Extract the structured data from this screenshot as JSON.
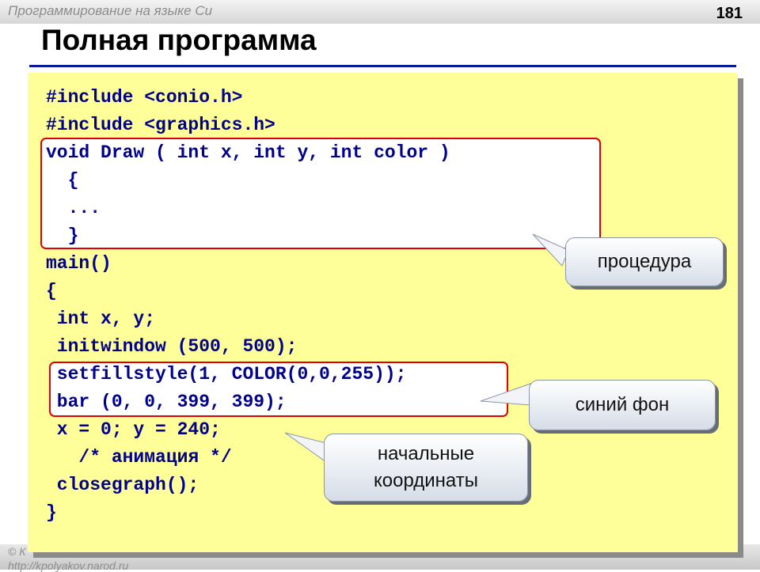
{
  "header": {
    "course": "Программирование на языке Си",
    "page_number": "181"
  },
  "slide": {
    "title": "Полная программа"
  },
  "code": {
    "lines": [
      "#include <conio.h>",
      "#include <graphics.h>",
      "void Draw ( int x, int y, int color )",
      "  {",
      "  ...",
      "  }",
      "main()",
      "{",
      " int x, y;",
      " initwindow (500, 500);",
      " setfillstyle(1, COLOR(0,0,255));",
      " bar (0, 0, 399, 399);",
      " x = 0; y = 240;",
      "   /* анимация */",
      " closegraph();",
      "}"
    ]
  },
  "callouts": {
    "procedure": "процедура",
    "blue_bg": "синий фон",
    "coords": "начальные\nкоординаты"
  },
  "footer": {
    "copyright": "© К",
    "url": "http://kpolyakov.narod.ru"
  },
  "colors": {
    "panel": "#ffff99",
    "code": "#00008b",
    "highlight_border": "#e00000",
    "title_rule": "#0b1a9a"
  }
}
